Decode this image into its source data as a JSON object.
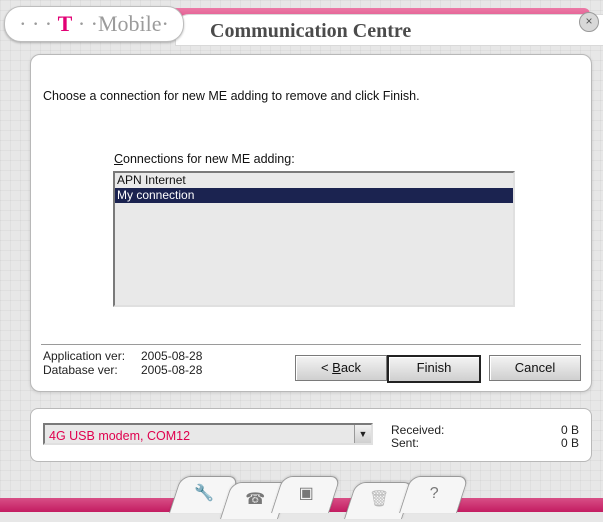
{
  "window": {
    "brand_dots": "· · ·",
    "brand_t": "T",
    "brand_mid": "· ·",
    "brand_name": "Mobile",
    "brand_end": "·",
    "title": "Communication Centre",
    "close_glyph": "×"
  },
  "dialog": {
    "instruction": "Choose a connection for new ME adding to remove and click Finish.",
    "list_label_access": "C",
    "list_label_rest": "onnections for new ME adding:",
    "connections": [
      "APN Internet",
      "My connection"
    ],
    "selected_index": 1
  },
  "versions": {
    "app_label": "Application ver:",
    "app_value": "2005-08-28",
    "db_label": "Database ver:",
    "db_value": "2005-08-28"
  },
  "buttons": {
    "back_prefix": "< ",
    "back_access": "B",
    "back_rest": "ack",
    "finish": "Finish",
    "cancel": "Cancel"
  },
  "modem": {
    "selected": "4G USB modem, COM12",
    "received_label": "Received:",
    "received_value": "0 B",
    "sent_label": "Sent:",
    "sent_value": "0 B"
  },
  "toolbar": {
    "icons": [
      "wrench-icon",
      "phone-icon",
      "mobile-device-icon",
      "trash-icon",
      "help-icon"
    ],
    "glyphs": [
      "🔧",
      "☎",
      "▣",
      "🗑",
      "?"
    ]
  },
  "colors": {
    "brand_magenta": "#e20074",
    "selection": "#1b2350",
    "modem_text": "#e0004e"
  }
}
